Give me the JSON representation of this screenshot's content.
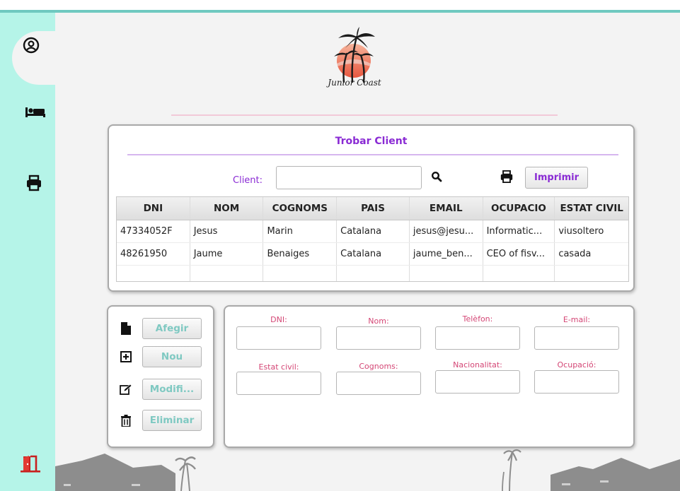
{
  "colors": {
    "accent": "#8a2bd4",
    "sidebar": "#b5f4e8",
    "teal_text": "#7fc9c2",
    "pink_text": "#d44675",
    "exit_red": "#c8201f"
  },
  "sidebar": {
    "items": [
      {
        "icon": "user-circle-icon"
      },
      {
        "icon": "bed-icon"
      },
      {
        "icon": "printer-icon"
      },
      {
        "icon": "exit-door-icon"
      }
    ]
  },
  "logo": {
    "text": "Junior Coast"
  },
  "search": {
    "title": "Trobar Client",
    "client_label": "Client:",
    "client_value": "",
    "print_label": "Imprimir"
  },
  "table": {
    "headers": [
      "DNI",
      "NOM",
      "COGNOMS",
      "PAIS",
      "EMAIL",
      "OCUPACIO",
      "ESTAT CIVIL"
    ],
    "rows": [
      [
        "47334052F",
        "Jesus",
        "Marin",
        "Catalana",
        "jesus@jesu...",
        "Informatic...",
        "viusoltero"
      ],
      [
        "48261950",
        "Jaume",
        "Benaiges",
        "Catalana",
        "jaume_ben...",
        "CEO of fisv...",
        "casada"
      ]
    ]
  },
  "actions": {
    "add": "Afegir",
    "new": "Nou",
    "modify": "Modifi...",
    "delete": "Eliminar"
  },
  "form": {
    "dni_label": "DNI:",
    "nom_label": "Nom:",
    "telefon_label": "Telèfon:",
    "email_label": "E-mail:",
    "estat_label": "Estat civil:",
    "cognoms_label": "Cognoms:",
    "nacionalitat_label": "Nacionalitat:",
    "ocupacio_label": "Ocupació:"
  }
}
